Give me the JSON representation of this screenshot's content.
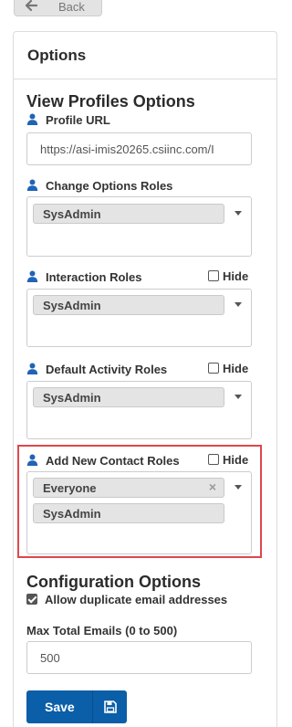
{
  "top": {
    "back_label": "Back"
  },
  "panel": {
    "title": "Options"
  },
  "view_profiles": {
    "title": "View Profiles Options",
    "profile_url_label": "Profile URL",
    "profile_url_value": "https://asi-imis20265.csiinc.com/I",
    "fields": [
      {
        "label": "Change Options Roles",
        "hide_label": "",
        "roles": [
          "SysAdmin"
        ]
      },
      {
        "label": "Interaction Roles",
        "hide_label": "Hide",
        "roles": [
          "SysAdmin"
        ]
      },
      {
        "label": "Default Activity Roles",
        "hide_label": "Hide",
        "roles": [
          "SysAdmin"
        ]
      },
      {
        "label": "Add New Contact Roles",
        "hide_label": "Hide",
        "roles": [
          "Everyone",
          "SysAdmin"
        ]
      }
    ]
  },
  "configuration": {
    "title": "Configuration Options",
    "allow_duplicate_label": "Allow duplicate email addresses",
    "allow_duplicate_checked": true,
    "max_emails_label": "Max Total Emails (0 to 500)",
    "max_emails_value": "500"
  },
  "actions": {
    "save_label": "Save"
  },
  "colors": {
    "primary": "#0b5ea8",
    "user_icon": "#1f64b6",
    "highlight": "#e0474c"
  }
}
